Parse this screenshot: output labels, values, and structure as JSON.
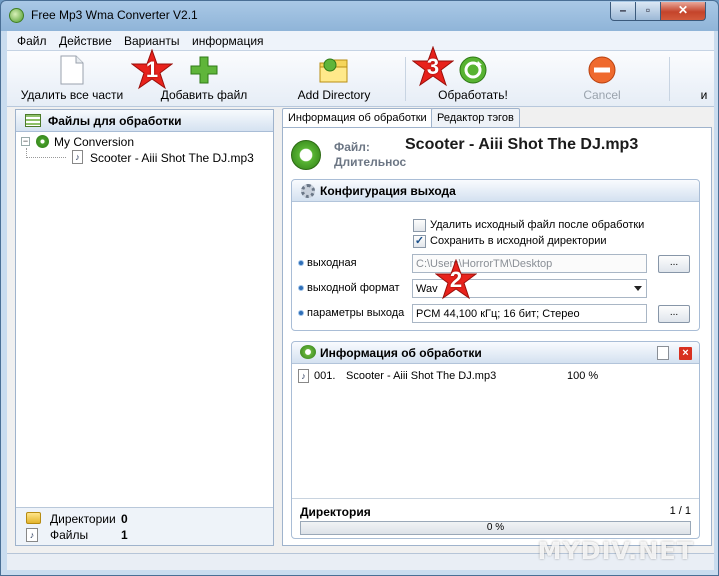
{
  "window": {
    "title": "Free Mp3 Wma Converter V2.1"
  },
  "menu": {
    "items": [
      "Файл",
      "Действие",
      "Варианты",
      "информация"
    ]
  },
  "toolbar": {
    "remove_all": "Удалить все части",
    "add_file": "Добавить файл",
    "add_directory": "Add Directory",
    "process": "Обработать!",
    "cancel": "Cancel",
    "more": "и"
  },
  "badges": [
    "1",
    "2",
    "3"
  ],
  "left_panel": {
    "header": "Файлы для обработки",
    "conversion": "My Conversion",
    "file": "Scooter - Aiii Shot The DJ.mp3",
    "directories_label": "Директории",
    "directories_count": "0",
    "files_label": "Файлы",
    "files_count": "1"
  },
  "tabs": [
    "Информация об обработки",
    "Редактор тэгов"
  ],
  "file_info": {
    "file_label": "Файл:",
    "duration_label": "Длительнос",
    "file_name": "Scooter - Aiii Shot The DJ.mp3"
  },
  "output_config": {
    "header": "Конфигурация выхода",
    "delete_source": "Удалить исходный файл после обработки",
    "delete_source_checked": false,
    "save_in_source": "Сохранить в исходной директории",
    "save_in_source_checked": true,
    "output_label": "выходная",
    "output_path": "C:\\Users\\HorrorTM\\Desktop",
    "format_label": "выходной формат",
    "format_value": "Wav",
    "params_label": "параметры выхода",
    "params_value": "PCM 44,100 кГц; 16 бит; Стерео",
    "browse_label": "..."
  },
  "process_info": {
    "header": "Информация об обработки",
    "close_label": "×",
    "rows": [
      {
        "num": "001.",
        "name": "Scooter - Aiii Shot The DJ.mp3",
        "percent": "100 %"
      }
    ],
    "directory_label": "Директория",
    "directory_count": "1 / 1",
    "progress_text": "0 %",
    "progress_value": 0
  },
  "watermark": "MYDIV.NET",
  "colors": {
    "badge_red": "#e8221c",
    "accent_green": "#3f9a22"
  }
}
